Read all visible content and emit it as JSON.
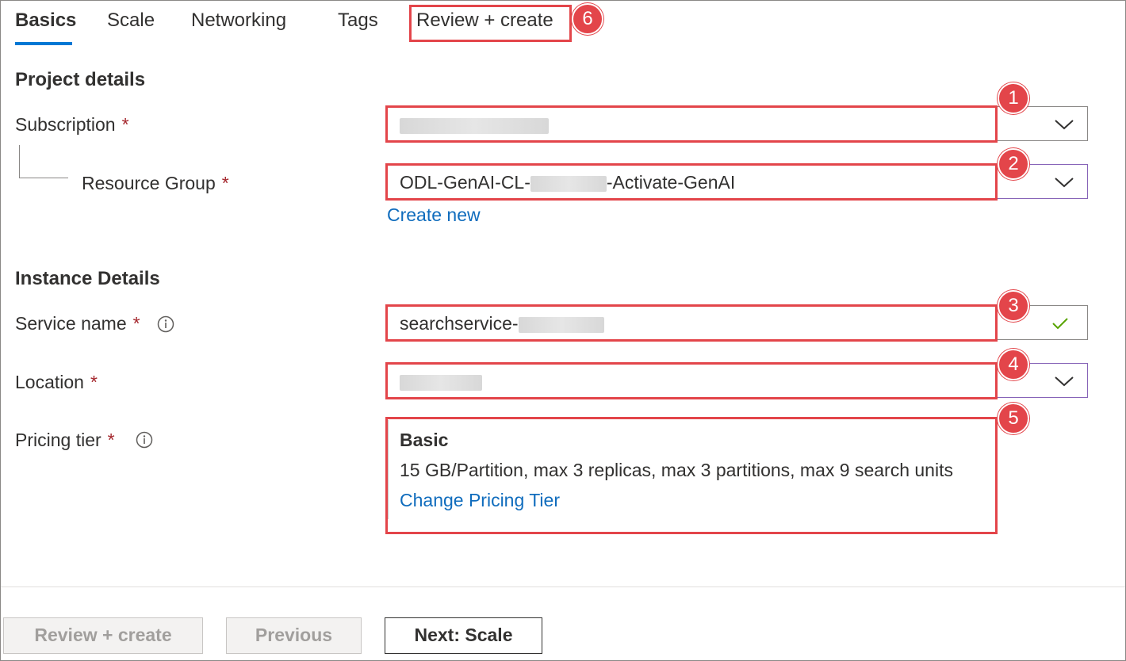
{
  "tabs": [
    {
      "label": "Basics",
      "active": true
    },
    {
      "label": "Scale"
    },
    {
      "label": "Networking"
    },
    {
      "label": "Tags"
    },
    {
      "label": "Review + create"
    }
  ],
  "project_details": {
    "title": "Project details",
    "subscription": {
      "label": "Subscription",
      "required": "*",
      "value": ""
    },
    "resource_group": {
      "label": "Resource Group",
      "required": "*",
      "value_prefix": "ODL-GenAI-CL-",
      "value_suffix": "-Activate-GenAI",
      "create_new": "Create new"
    }
  },
  "instance_details": {
    "title": "Instance Details",
    "service_name": {
      "label": "Service name",
      "required": "*",
      "value": "searchservice-"
    },
    "location": {
      "label": "Location",
      "required": "*",
      "value": ""
    },
    "pricing_tier": {
      "label": "Pricing tier",
      "required": "*",
      "tier_name": "Basic",
      "description": "15 GB/Partition, max 3 replicas, max 3 partitions, max 9 search units",
      "change_link": "Change Pricing Tier"
    }
  },
  "annotations": [
    "1",
    "2",
    "3",
    "4",
    "5",
    "6"
  ],
  "footer": {
    "review_create": "Review + create",
    "previous": "Previous",
    "next": "Next: Scale"
  },
  "colors": {
    "accent": "#0078d4",
    "annotation": "#e3454a",
    "required": "#a4262c",
    "link": "#0f6cbd",
    "valid": "#57a300"
  }
}
